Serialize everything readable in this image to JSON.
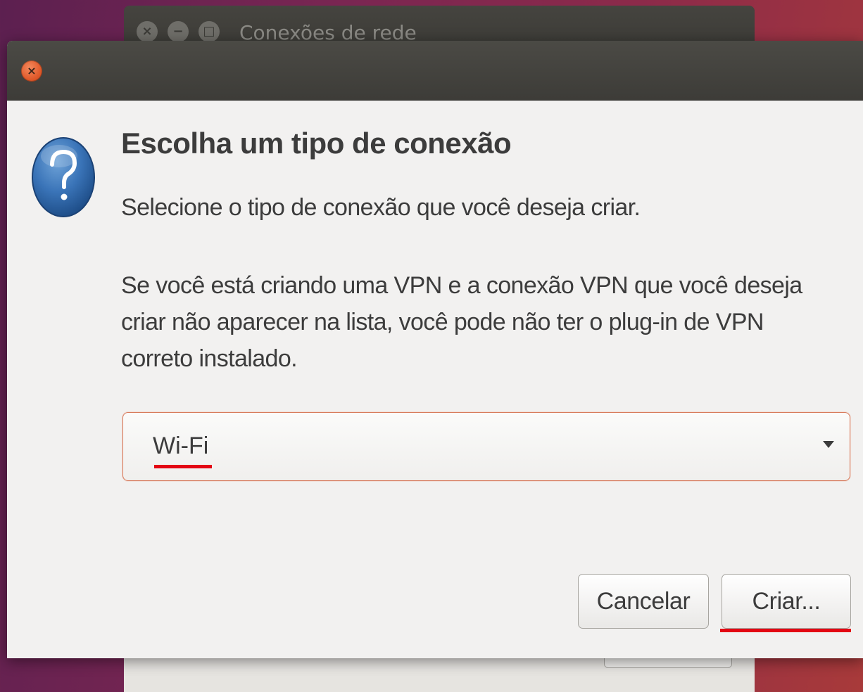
{
  "background_window": {
    "title": "Conexões de rede",
    "controls": [
      "×",
      "−",
      "□"
    ]
  },
  "dialog": {
    "close_icon": "×",
    "heading": "Escolha um tipo de conexão",
    "subtitle": "Selecione o tipo de conexão que você deseja criar.",
    "note": "Se você está criando uma VPN e a conexão VPN que você deseja criar não aparecer na lista, você pode não ter o plug-in de VPN correto instalado.",
    "connection_type": {
      "selected": "Wi-Fi"
    },
    "buttons": {
      "cancel": "Cancelar",
      "create": "Criar..."
    }
  },
  "colors": {
    "accent_close": "#e05a2b",
    "annotation_underline": "#e30613",
    "combo_border": "#d7795a",
    "dialog_bg": "#f2f1f0"
  },
  "icons": {
    "dialog_icon": "question-icon",
    "dropdown": "chevron-down-icon"
  }
}
